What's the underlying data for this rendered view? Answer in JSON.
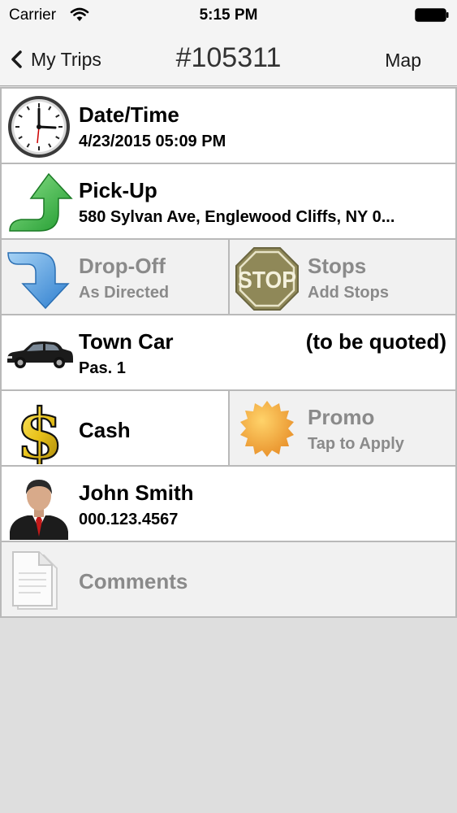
{
  "status_bar": {
    "carrier": "Carrier",
    "time": "5:15 PM"
  },
  "nav": {
    "back_label": "My Trips",
    "title": "#105311",
    "map_label": "Map"
  },
  "rows": {
    "datetime": {
      "title": "Date/Time",
      "value": "4/23/2015 05:09 PM"
    },
    "pickup": {
      "title": "Pick-Up",
      "value": "580 Sylvan Ave, Englewood Cliffs, NY 0..."
    },
    "dropoff": {
      "title": "Drop-Off",
      "value": "As Directed"
    },
    "stops": {
      "title": "Stops",
      "value": "Add Stops",
      "sign_text": "STOP"
    },
    "vehicle": {
      "title": "Town Car",
      "value": "Pas. 1",
      "price": "(to be quoted)"
    },
    "payment": {
      "title": "Cash"
    },
    "promo": {
      "title": "Promo",
      "value": "Tap to Apply"
    },
    "passenger": {
      "name": "John Smith",
      "phone": "000.123.4567"
    },
    "comments": {
      "title": "Comments"
    }
  },
  "icons": {
    "datetime": "clock-icon",
    "pickup": "green-up-arrow-icon",
    "dropoff": "blue-down-arrow-icon",
    "stops": "stop-sign-icon",
    "vehicle": "car-icon",
    "payment": "dollar-icon",
    "promo": "promo-badge-icon",
    "passenger": "person-icon",
    "comments": "document-icon"
  },
  "colors": {
    "pickup_arrow": "#3fb84a",
    "dropoff_arrow": "#3c8fd8",
    "stop_sign": "#8f8858",
    "dollar": "#e8c21a",
    "promo_badge": "#f0a830",
    "tie": "#c41a1a"
  }
}
